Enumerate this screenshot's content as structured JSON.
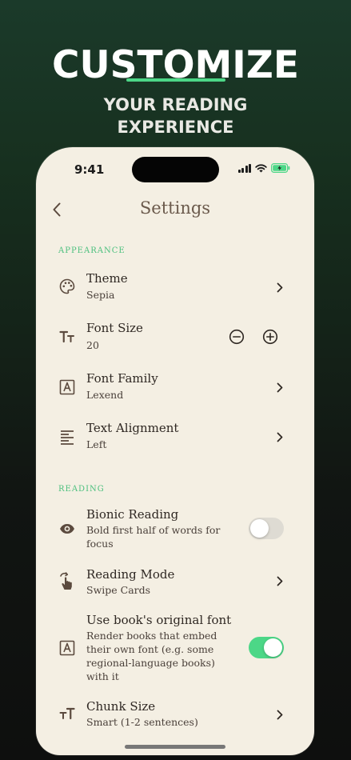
{
  "headline": {
    "title": "CUSTOMIZE",
    "subtitle_line1": "YOUR READING",
    "subtitle_line2": "EXPERIENCE",
    "accent_color": "#4cd787"
  },
  "status_bar": {
    "time": "9:41"
  },
  "nav": {
    "title": "Settings"
  },
  "sections": {
    "appearance": {
      "label": "APPEARANCE"
    },
    "reading": {
      "label": "READING"
    }
  },
  "settings": {
    "theme": {
      "title": "Theme",
      "value": "Sepia",
      "icon": "palette-icon"
    },
    "font_size": {
      "title": "Font Size",
      "value": "20",
      "icon": "text-size-icon"
    },
    "font_family": {
      "title": "Font Family",
      "value": "Lexend",
      "icon": "font-family-icon"
    },
    "text_alignment": {
      "title": "Text Alignment",
      "value": "Left",
      "icon": "align-left-icon"
    },
    "bionic_reading": {
      "title": "Bionic Reading",
      "description": "Bold first half of words for focus",
      "enabled": false,
      "icon": "eye-icon"
    },
    "reading_mode": {
      "title": "Reading Mode",
      "value": "Swipe Cards",
      "icon": "swipe-hand-icon"
    },
    "original_font": {
      "title": "Use book's original font",
      "description": "Render books that embed their own font (e.g. some regional-language books) with it",
      "enabled": true,
      "icon": "font-family-icon"
    },
    "chunk_size": {
      "title": "Chunk Size",
      "value": "Smart (1-2 sentences)",
      "icon": "chunk-size-icon"
    }
  },
  "colors": {
    "accent_green": "#4cd787",
    "section_label": "#4cc07e",
    "background": "#f4efe3",
    "text_primary": "#2f2823",
    "title_text": "#6b5a4c"
  }
}
